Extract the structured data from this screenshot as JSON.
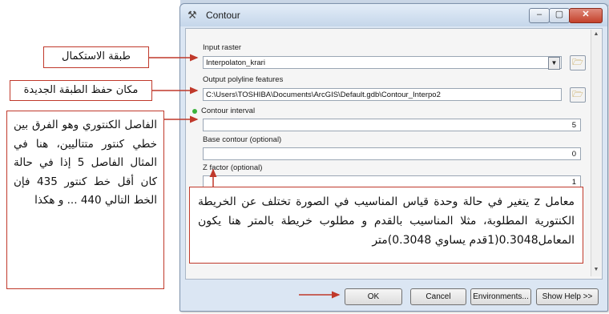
{
  "window": {
    "title": "Contour",
    "title_icon": "hammer-icon",
    "minimize": "–",
    "maximize": "▢",
    "close": "✕"
  },
  "form": {
    "input_raster_label": "Input raster",
    "input_raster_value": "Interpolaton_krari",
    "output_label": "Output polyline features",
    "output_value": "C:\\Users\\TOSHIBA\\Documents\\ArcGIS\\Default.gdb\\Contour_Interpo2",
    "interval_label": "Contour interval",
    "interval_value": "5",
    "base_label": "Base contour (optional)",
    "base_value": "0",
    "zfactor_label": "Z factor (optional)",
    "zfactor_value": "1"
  },
  "buttons": {
    "ok": "OK",
    "cancel": "Cancel",
    "environments": "Environments...",
    "show_help": "Show Help >>"
  },
  "annotations": {
    "input_layer": "طبقة الاستكمال",
    "save_location": "مكان حفظ الطبقة الجديدة",
    "interval_note": "الفاصل الكنتوري وهو الفرق بين خطي كنتور متتاليين، هنا في المثال الفاصل 5 إذا في حالة كان أقل خط كنتور 435 فإن الخط التالي 440 ... و هكذا",
    "zfactor_note": "معامل z يتغير في حالة وحدة قياس المناسيب في الصورة تختلف عن الخريطة الكنتورية المطلوبة، مثلا المناسيب بالقدم و مطلوب خريطة بالمتر هنا يكون المعامل0.3048(1قدم يساوي 0.3048)متر"
  },
  "colors": {
    "annotation_red": "#c0392b",
    "window_frame": "#dbe6f3",
    "valid_dot": "#3bb23b"
  }
}
